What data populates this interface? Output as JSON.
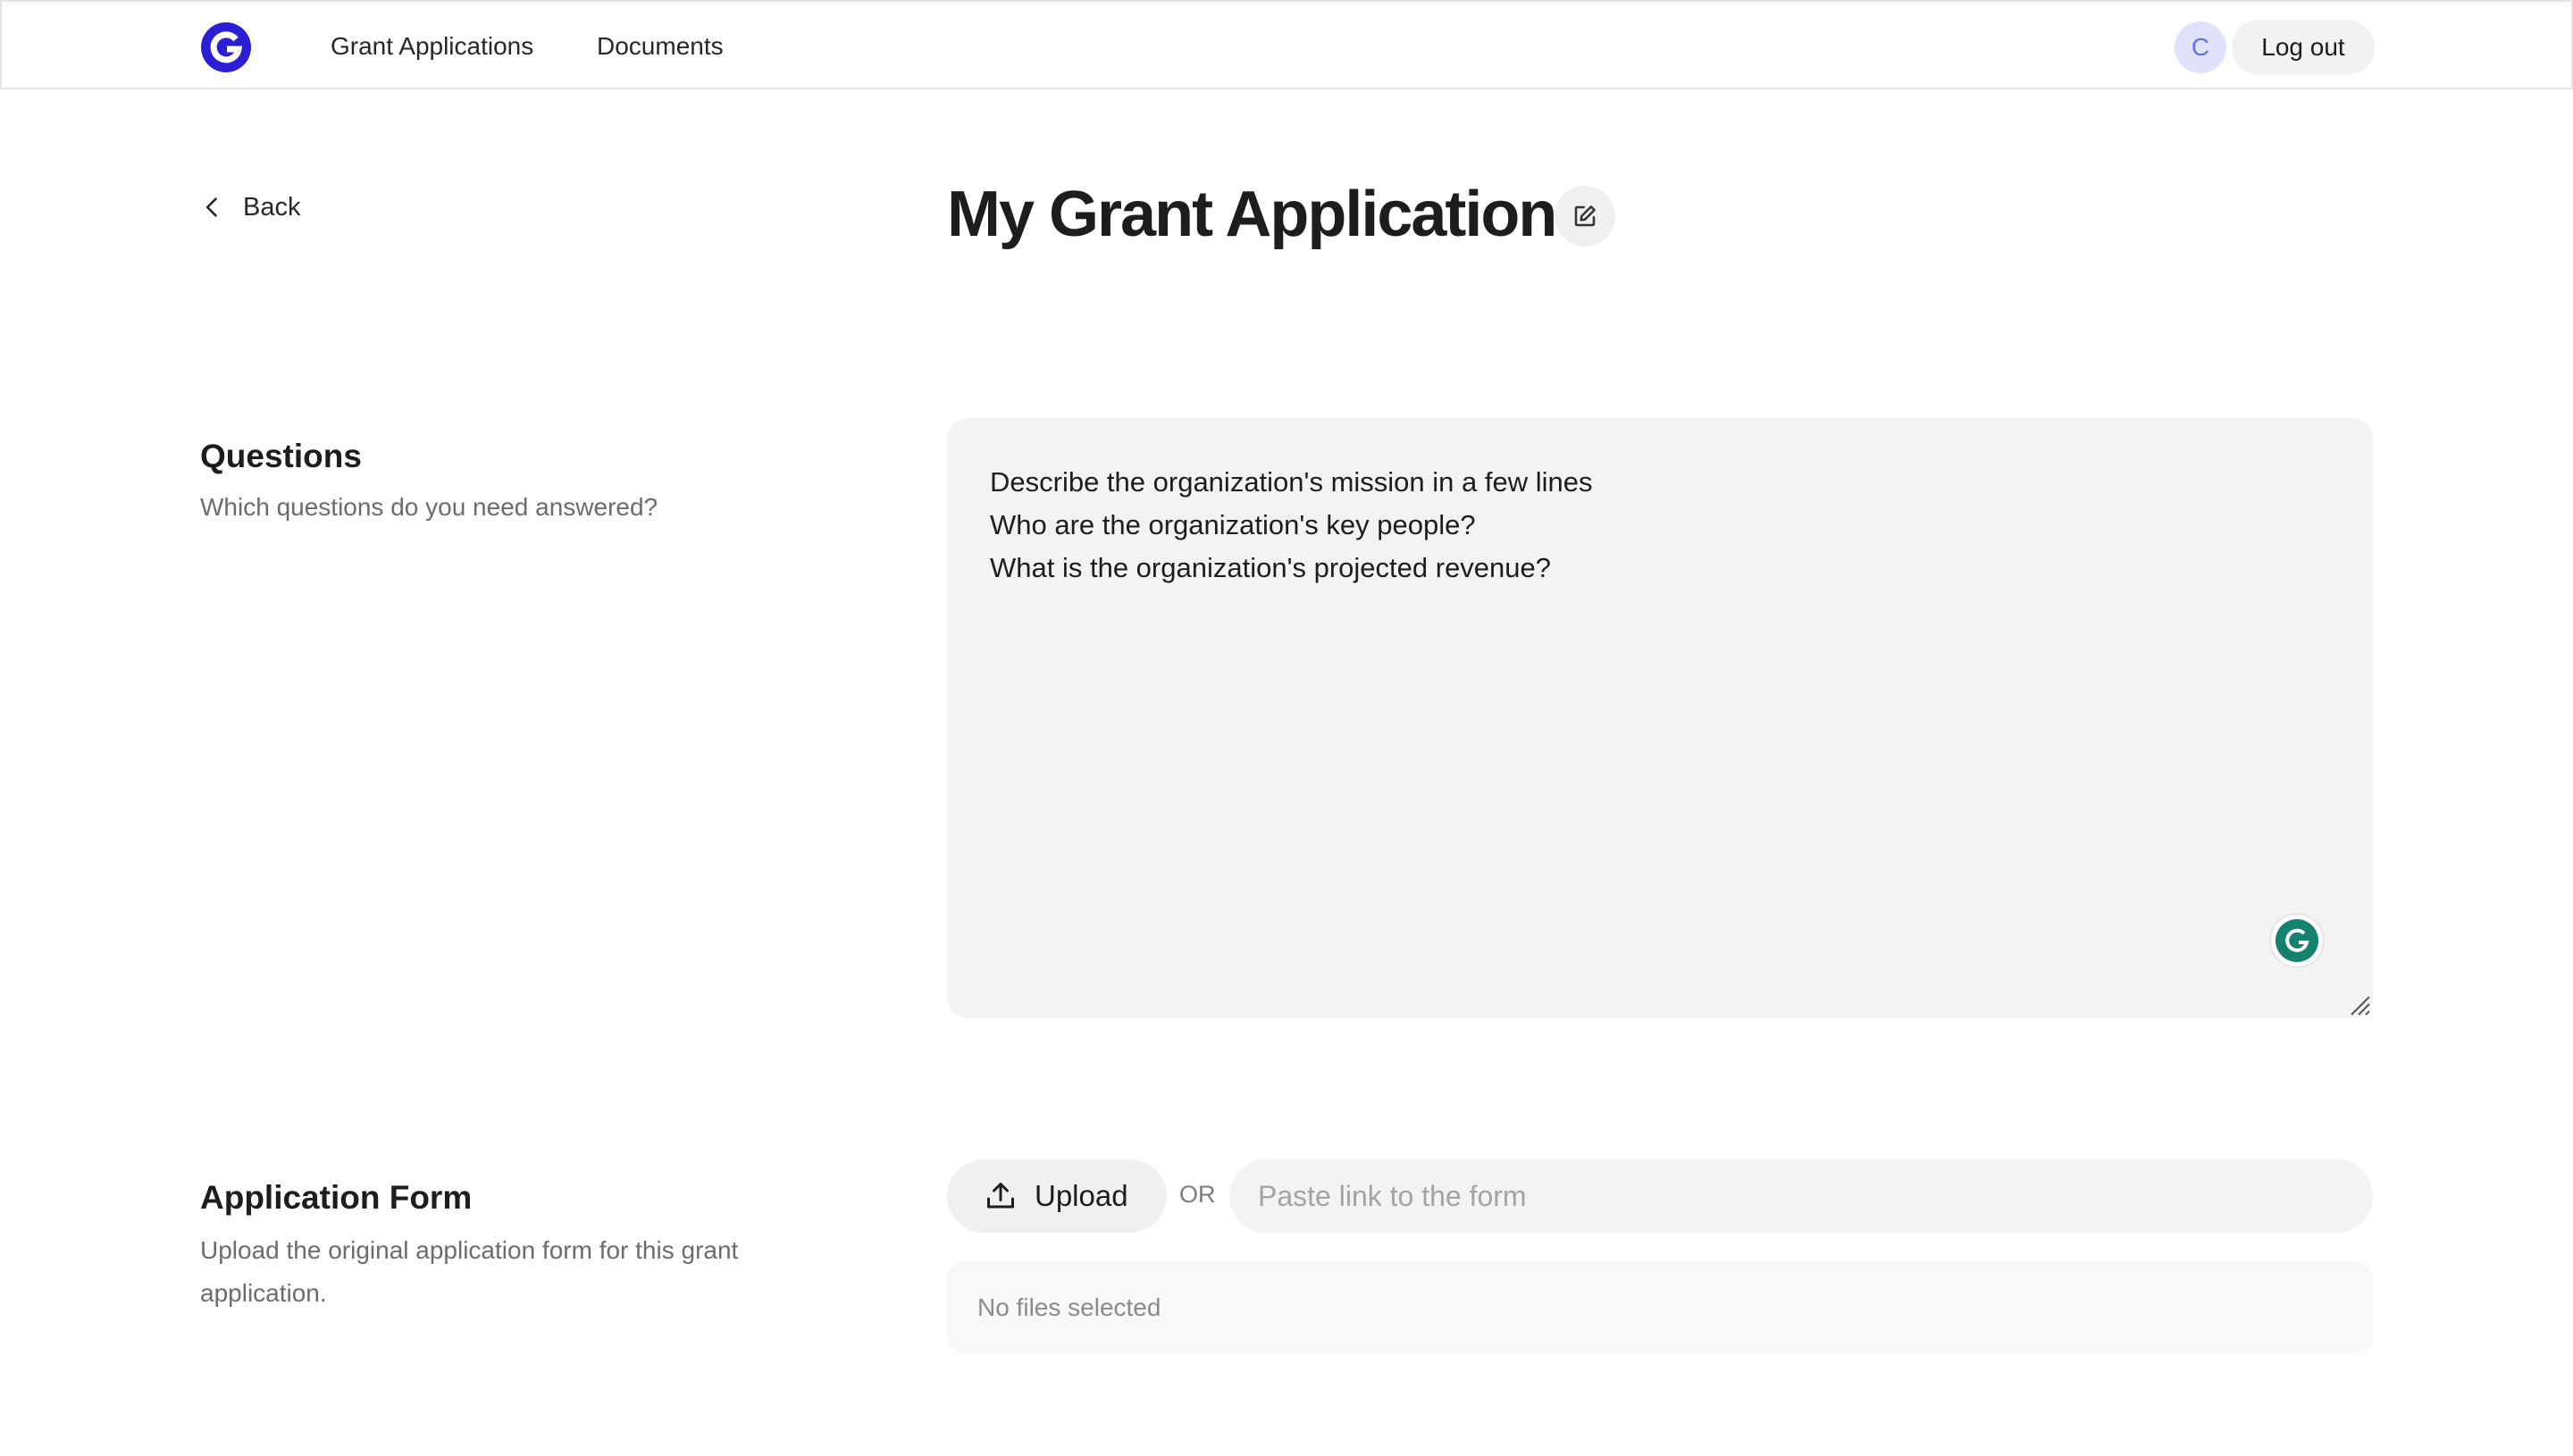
{
  "nav": {
    "links": [
      "Grant Applications",
      "Documents"
    ],
    "avatar_initial": "C",
    "logout_label": "Log out"
  },
  "back_label": "Back",
  "page_title": "My Grant Application",
  "questions": {
    "title": "Questions",
    "subtitle": "Which questions do you need answered?",
    "value": "Describe the organization's mission in a few lines\nWho are the organization's key people?\nWhat is the organization's projected revenue?"
  },
  "application_form": {
    "title": "Application Form",
    "subtitle": "Upload the original application form for this grant application.",
    "upload_label": "Upload",
    "or_label": "OR",
    "link_placeholder": "Paste link to the form",
    "files_status": "No files selected"
  },
  "colors": {
    "brand": "#2b1fd6",
    "grammarly": "#15826f"
  },
  "icons": [
    "logo",
    "chevron-left-icon",
    "edit-icon",
    "grammarly-icon",
    "upload-icon",
    "resize-handle-icon"
  ]
}
